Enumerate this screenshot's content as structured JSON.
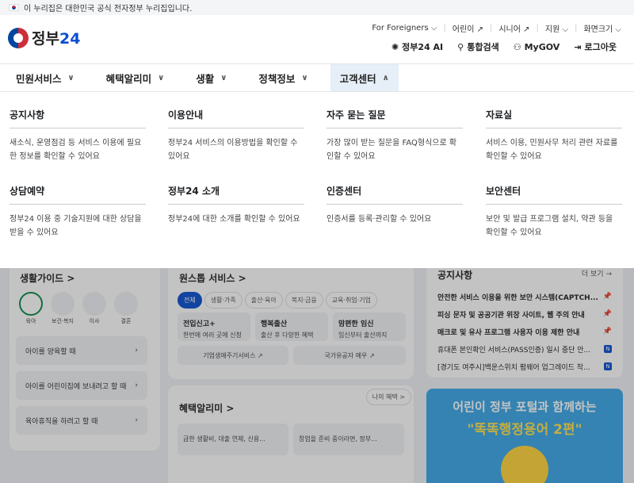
{
  "gov_banner": {
    "text": "이 누리집은 대한민국 공식 전자정부 누리집입니다."
  },
  "logo": {
    "text": "정부",
    "num": "24"
  },
  "util_links": [
    "For Foreigners ⌵",
    "어린이 ↗",
    "시니어 ↗",
    "지원 ⌵",
    "화면크기 ⌵"
  ],
  "quick_links": {
    "ai": "정부24 AI",
    "search": "통합검색",
    "mygov": "MyGOV",
    "logout": "로그아웃"
  },
  "nav": [
    {
      "label": "민원서비스"
    },
    {
      "label": "혜택알리미"
    },
    {
      "label": "생활"
    },
    {
      "label": "정책정보"
    },
    {
      "label": "고객센터"
    }
  ],
  "dropdown": [
    {
      "title": "공지사항",
      "desc": "새소식, 운영점검 등 서비스 이용에 필요한 정보를 확인할 수 있어요"
    },
    {
      "title": "이용안내",
      "desc": "정부24 서비스의 이용방법을 확인할 수 있어요"
    },
    {
      "title": "자주 묻는 질문",
      "desc": "가장 많이 받는 질문을 FAQ형식으로 확인할 수 있어요"
    },
    {
      "title": "자료실",
      "desc": "서비스 이용, 민원사무 처리 관련 자료를 확인할 수 있어요"
    },
    {
      "title": "상담예약",
      "desc": "정부24 이용 중 기술지원에 대한 상담을 받을 수 있어요"
    },
    {
      "title": "정부24 소개",
      "desc": "정부24에 대한 소개를 확인할 수 있어요"
    },
    {
      "title": "인증센터",
      "desc": "인증서를 등록·관리할 수 있어요"
    },
    {
      "title": "보안센터",
      "desc": "보안 및 발급 프로그램 설치, 약관 등을 확인할 수 있어요"
    }
  ],
  "life_guide": {
    "title": "생활가이드 >",
    "icons": [
      "육아",
      "보건·복지",
      "이사",
      "결혼",
      "임신"
    ],
    "rows": [
      "아이를 양육할 때",
      "아이를 어린이집에 보내려고 할 때",
      "육아휴직을 하려고 할 때"
    ]
  },
  "one_stop": {
    "title": "원스톱 서비스 >",
    "tabs": [
      "전체",
      "생활·가족",
      "출산·육아",
      "복지·금융",
      "교육·취업·기업"
    ],
    "boxes": [
      {
        "title": "전입신고+",
        "desc": "한번에 여러 곳에 신청"
      },
      {
        "title": "행복출산",
        "desc": "출산 후 다양한 혜택"
      },
      {
        "title": "맘편한 임신",
        "desc": "임신부터 출산까지"
      }
    ],
    "links": [
      "기업생애주기서비스 ↗",
      "국가유공자 예우 ↗"
    ]
  },
  "benefit": {
    "title": "혜택알리미 >",
    "my": "나의 혜택 >",
    "items": [
      "급한 생활비, 대출 연체, 신용...",
      "창업을 준비 중이라면, 정부..."
    ]
  },
  "notice": {
    "title": "공지사항",
    "more": "더 보기 →",
    "items": [
      "안전한 서비스 이용을 위한 보안 시스템(CAPTCH...",
      "피싱 문자 및 공공기관 위장 사이트, 웹 주의 안내",
      "매크로 및 유사 프로그램 사용자 이용 제한 안내",
      "휴대폰 본인확인 서비스(PASS인증) 일시 중단 안...",
      "[경기도 여주시]백운스위치 펌웨어 업그레이드 작..."
    ]
  },
  "banner": {
    "line1": "어린이 정부 포털과 함께하는",
    "line2": "\"똑똑행정용어 2편\""
  },
  "colors": {
    "accent": "#0b50d0",
    "nav_active_bg": "#e6eef8"
  }
}
